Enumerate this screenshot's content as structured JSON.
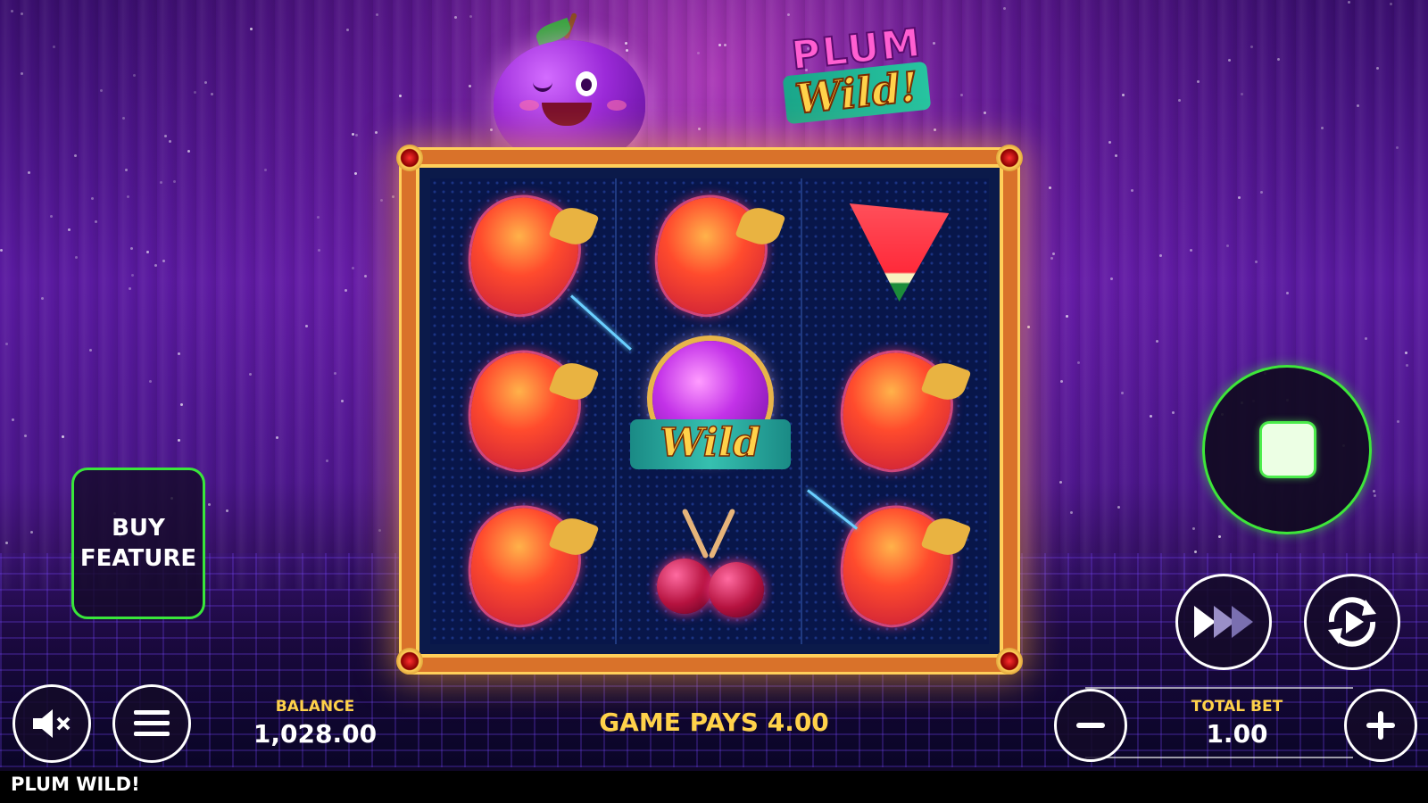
{
  "game": {
    "title": "PLUM WILD!",
    "logo_line1": "PLUM",
    "logo_line2": "Wild!"
  },
  "reels": [
    [
      "strawberry",
      "strawberry",
      "strawberry"
    ],
    [
      "strawberry",
      "wild",
      "cherry"
    ],
    [
      "watermelon",
      "strawberry",
      "strawberry"
    ]
  ],
  "wild_symbol_label": "Wild",
  "buy_feature": {
    "line1": "BUY",
    "line2": "FEATURE"
  },
  "balance": {
    "label": "BALANCE",
    "value": "1,028.00"
  },
  "game_pays": "GAME PAYS 4.00",
  "total_bet": {
    "label": "TOTAL BET",
    "value": "1.00"
  },
  "colors": {
    "accent_green": "#3ee63a",
    "label_gold": "#ffd24a",
    "frame_orange": "#d9722a",
    "background_purple": "#5a1aa0"
  },
  "icons": {
    "sound": "mute-icon",
    "menu": "hamburger-menu-icon",
    "spin": "stop-icon",
    "turbo": "fast-forward-icon",
    "autoplay": "autoplay-icon",
    "bet_minus": "minus-icon",
    "bet_plus": "plus-icon"
  }
}
